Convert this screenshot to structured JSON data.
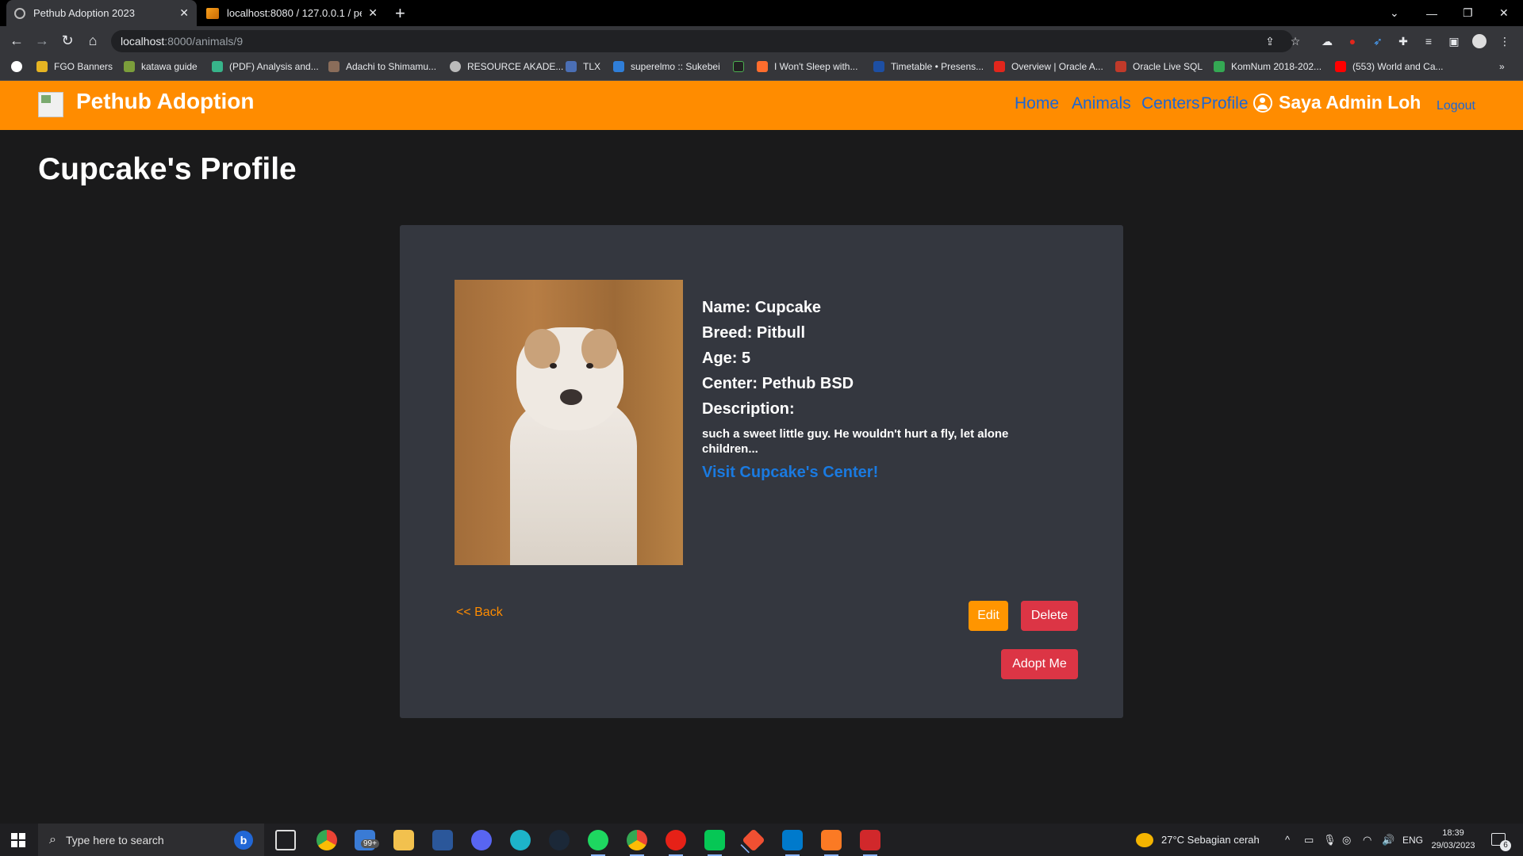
{
  "browser": {
    "tabs": [
      {
        "title": "Pethub Adoption 2023",
        "active": true,
        "icon": "globe-icon"
      },
      {
        "title": "localhost:8080 / 127.0.0.1 / peth",
        "active": false,
        "icon": "phpmyadmin-icon"
      }
    ],
    "url_host": "localhost",
    "url_path": ":8000/animals/9",
    "bookmarks": [
      {
        "label": "FGO Banners",
        "color": "#e6b422"
      },
      {
        "label": "katawa guide",
        "color": "#7b9e3b"
      },
      {
        "label": "(PDF) Analysis and...",
        "color": "#37b48a"
      },
      {
        "label": "Adachi to Shimamu...",
        "color": "#8a6d5a"
      },
      {
        "label": "RESOURCE AKADE...",
        "color": "#bbbbbb"
      },
      {
        "label": "TLX",
        "color": "#4b6fb5"
      },
      {
        "label": "superelmo :: Sukebei",
        "color": "#2f7ed8"
      },
      {
        "label": "",
        "color": "#222222"
      },
      {
        "label": "I Won't Sleep with...",
        "color": "#ff6d2d"
      },
      {
        "label": "Timetable • Presens...",
        "color": "#1d4fa3"
      },
      {
        "label": "Overview | Oracle A...",
        "color": "#e1261c"
      },
      {
        "label": "Oracle Live SQL",
        "color": "#c13a2a"
      },
      {
        "label": "KomNum 2018-202...",
        "color": "#34a853"
      },
      {
        "label": "(553) World and Ca...",
        "color": "#ff0000"
      }
    ]
  },
  "navbar": {
    "brand": "Pethub Adoption",
    "links": [
      "Home",
      "Animals",
      "Centers",
      "Profile"
    ],
    "user": "Saya Admin Loh",
    "logout": "Logout"
  },
  "page": {
    "title": "Cupcake's Profile"
  },
  "animal": {
    "name": "Name: Cupcake",
    "breed": "Breed: Pitbull",
    "age": "Age: 5",
    "center": "Center: Pethub BSD",
    "description_label": "Description:",
    "description": "such a sweet little guy. He wouldn't hurt a fly, let alone children...",
    "center_link": "Visit Cupcake's Center!"
  },
  "actions": {
    "back": "<< Back",
    "edit": "Edit",
    "delete": "Delete",
    "adopt": "Adopt Me"
  },
  "taskbar": {
    "search_placeholder": "Type here to search",
    "mail_badge": "99+",
    "weather": "27°C  Sebagian cerah",
    "language": "ENG",
    "time": "18:39",
    "date": "29/03/2023",
    "notification_count": "6"
  },
  "colors": {
    "navbar": "#ff8c00",
    "link": "#1a66d6",
    "danger": "#dc3545",
    "warning": "#ff9500"
  }
}
